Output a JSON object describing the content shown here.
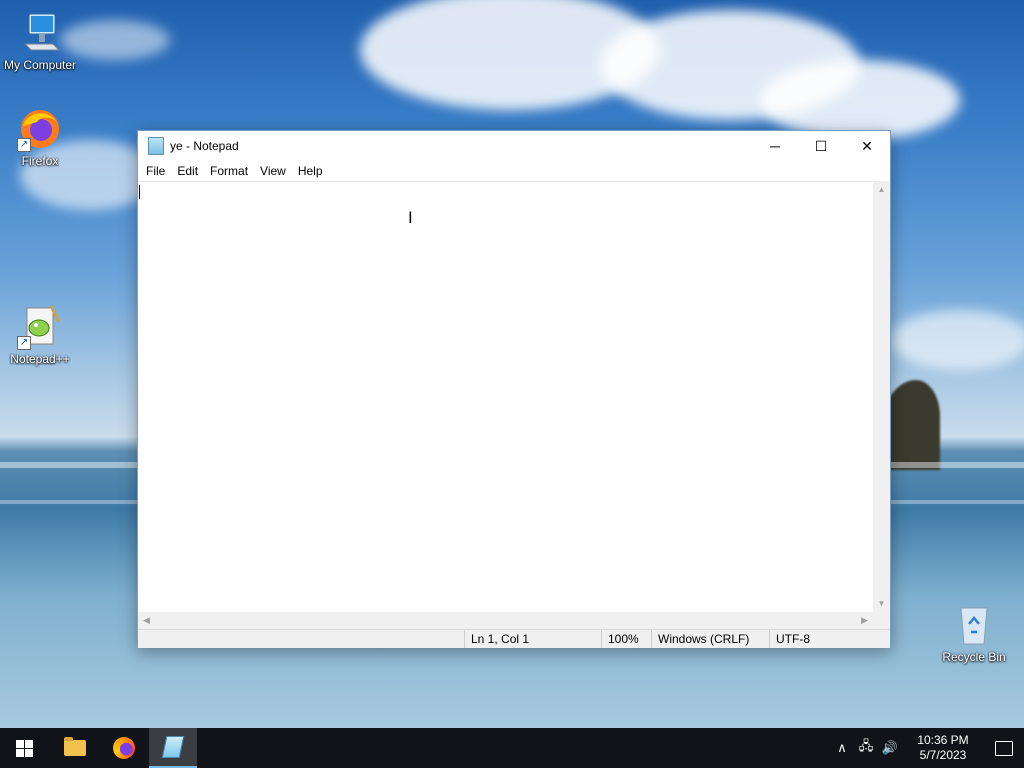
{
  "desktop": {
    "icons": {
      "my_computer": "My Computer",
      "firefox": "Firefox",
      "notepadpp": "Notepad++",
      "recycle_bin": "Recycle Bin"
    }
  },
  "window": {
    "title": "ye - Notepad",
    "controls": {
      "minimize": "─",
      "maximize": "☐",
      "close": "✕"
    },
    "menu": {
      "file": "File",
      "edit": "Edit",
      "format": "Format",
      "view": "View",
      "help": "Help"
    },
    "editor": {
      "content": ""
    },
    "status": {
      "position": "Ln 1, Col 1",
      "zoom": "100%",
      "line_ending": "Windows (CRLF)",
      "encoding": "UTF-8"
    }
  },
  "taskbar": {
    "clock": {
      "time": "10:36 PM",
      "date": "5/7/2023"
    },
    "tray": {
      "chevron": "∧",
      "network": "🖧",
      "volume": "🔊"
    }
  },
  "colors": {
    "taskbar": "#101418",
    "accent": "#76b9ed"
  }
}
